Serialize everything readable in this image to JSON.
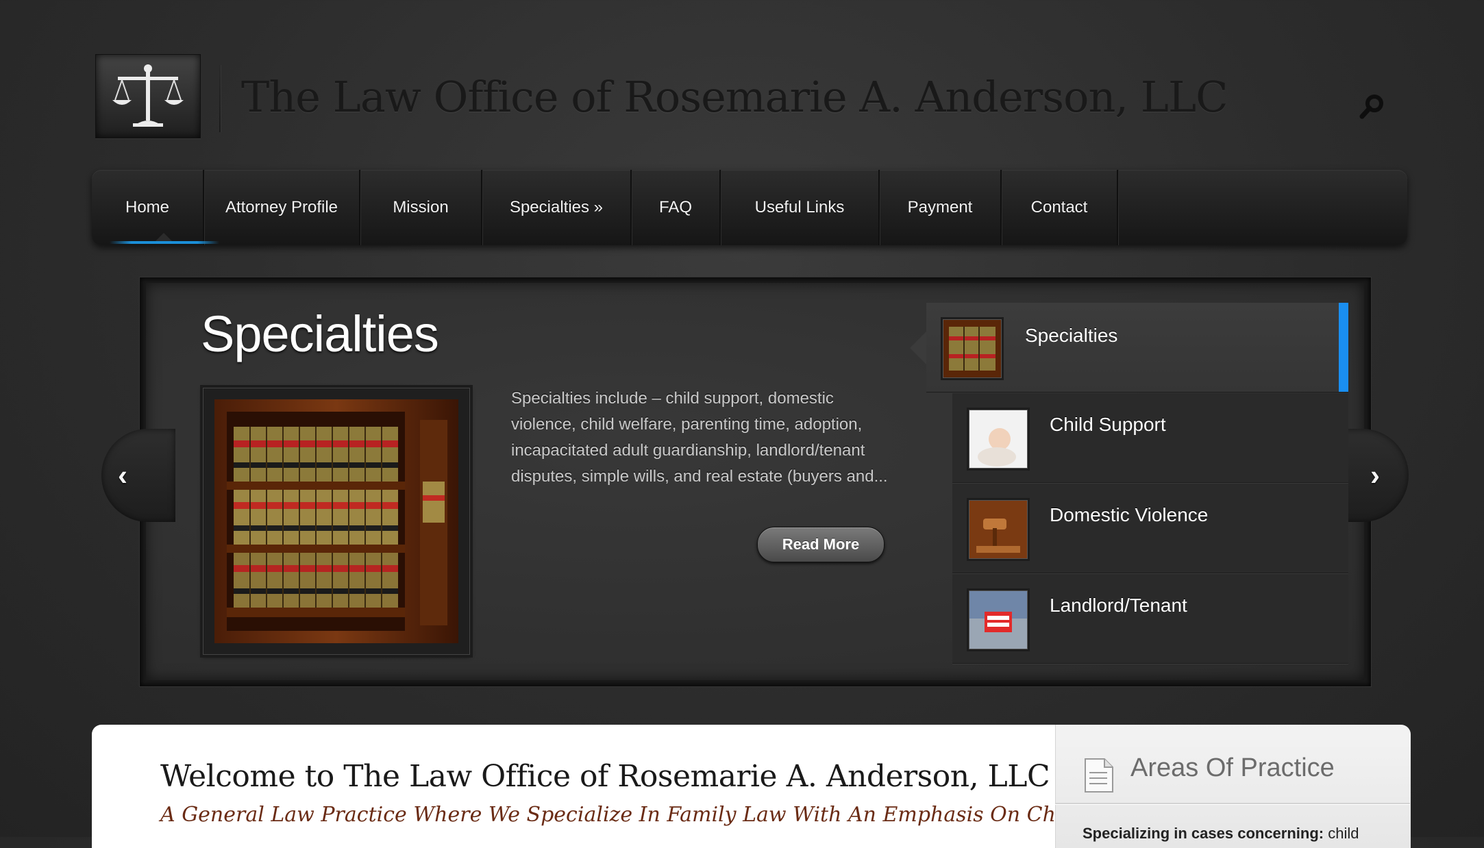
{
  "site": {
    "title": "The Law Office of Rosemarie A. Anderson, LLC"
  },
  "nav": {
    "items": [
      {
        "label": "Home",
        "active": true
      },
      {
        "label": "Attorney Profile"
      },
      {
        "label": "Mission"
      },
      {
        "label": "Specialties »"
      },
      {
        "label": "FAQ"
      },
      {
        "label": "Useful Links"
      },
      {
        "label": "Payment"
      },
      {
        "label": "Contact"
      }
    ]
  },
  "slider": {
    "title": "Specialties",
    "description": "Specialties include – child support, domestic violence, child welfare, parenting time, adoption, incapacitated adult guardianship, landlord/tenant disputes, simple wills, and real estate (buyers and...",
    "read_more": "Read More",
    "prev_symbol": "‹",
    "next_symbol": "›",
    "thumbnails": [
      {
        "label": "Specialties",
        "active": true
      },
      {
        "label": "Child Support"
      },
      {
        "label": "Domestic Violence"
      },
      {
        "label": "Landlord/Tenant"
      }
    ]
  },
  "content": {
    "welcome_title": "Welcome to The Law Office of Rosemarie A. Anderson, LLC",
    "welcome_subtitle": "A General Law Practice Where We Specialize In Family Law With An Emphasis On Child"
  },
  "sidebar": {
    "title": "Areas Of Practice",
    "text_bold": "Specializing in cases concerning:",
    "text_rest": " child"
  },
  "colors": {
    "accent_blue": "#1a8ef0",
    "subtitle_brown": "#6a2b14"
  },
  "icons": {
    "logo": "scales-of-justice-icon",
    "search": "search-icon",
    "sidebar": "document-icon"
  }
}
